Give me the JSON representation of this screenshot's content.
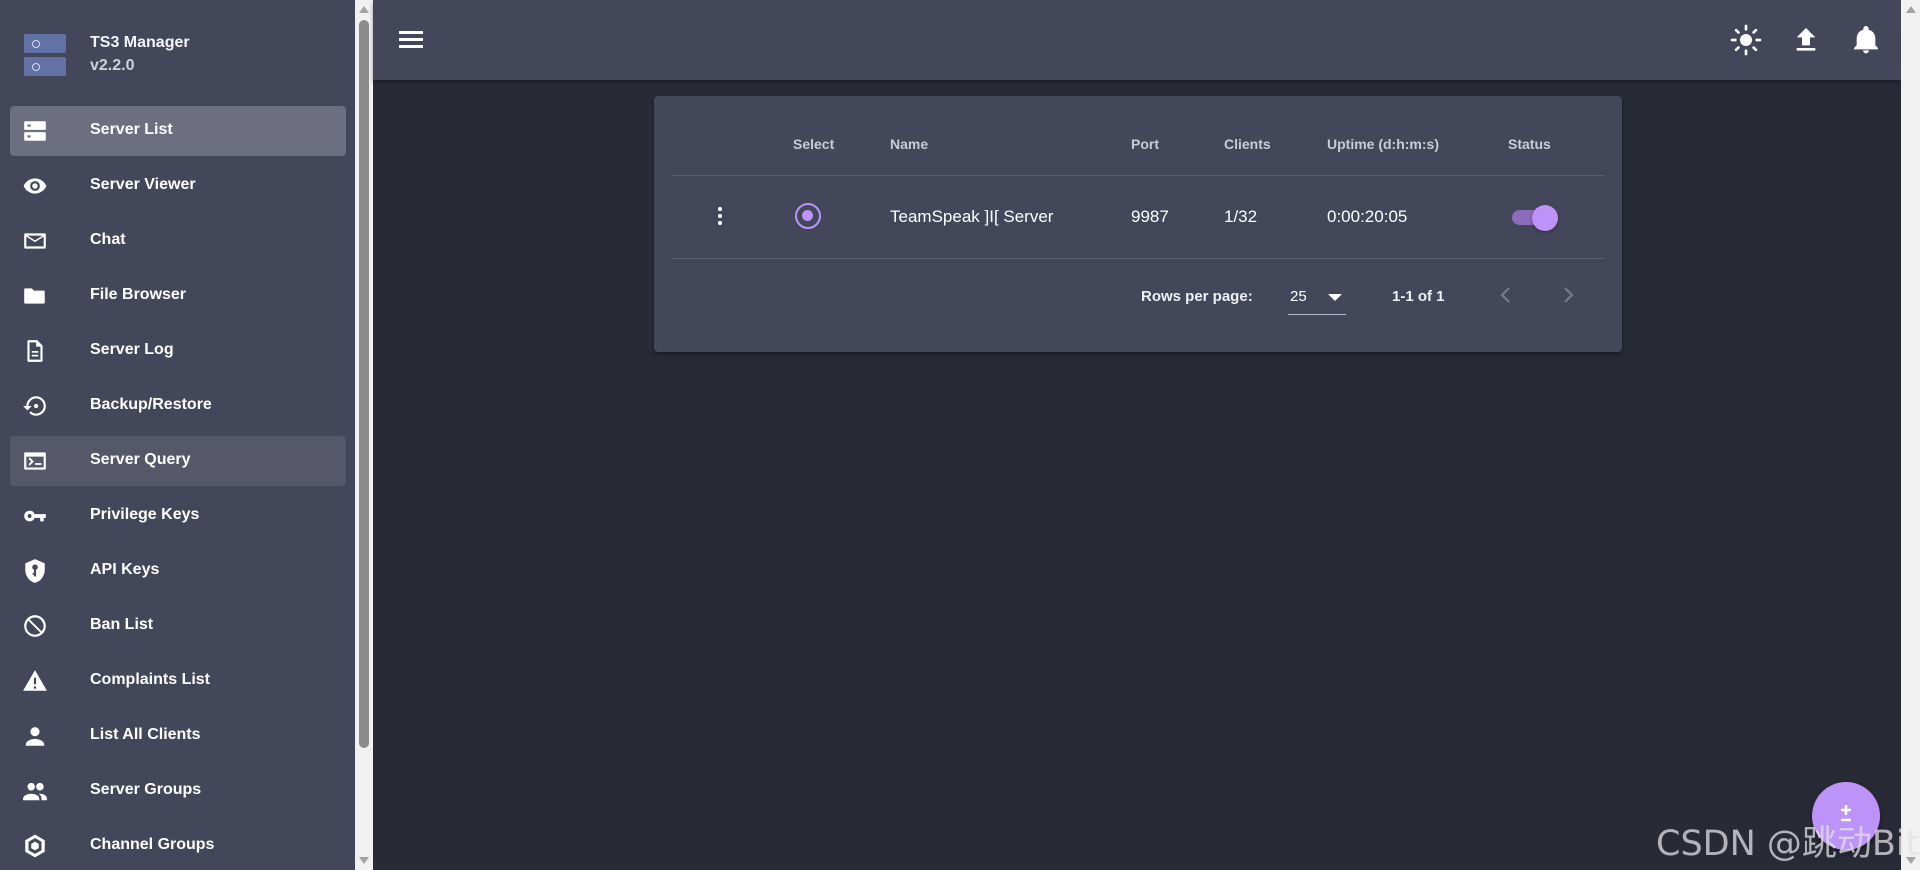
{
  "brand": {
    "title": "TS3 Manager",
    "version": "v2.2.0"
  },
  "sidebar": {
    "items": [
      {
        "label": "Server List",
        "icon": "server-list-icon"
      },
      {
        "label": "Server Viewer",
        "icon": "eye-icon"
      },
      {
        "label": "Chat",
        "icon": "envelope-icon"
      },
      {
        "label": "File Browser",
        "icon": "folder-icon"
      },
      {
        "label": "Server Log",
        "icon": "document-icon"
      },
      {
        "label": "Backup/Restore",
        "icon": "backup-restore-icon"
      },
      {
        "label": "Server Query",
        "icon": "console-icon"
      },
      {
        "label": "Privilege Keys",
        "icon": "key-icon"
      },
      {
        "label": "API Keys",
        "icon": "shield-key-icon"
      },
      {
        "label": "Ban List",
        "icon": "ban-icon"
      },
      {
        "label": "Complaints List",
        "icon": "warning-icon"
      },
      {
        "label": "List All Clients",
        "icon": "person-icon"
      },
      {
        "label": "Server Groups",
        "icon": "group-icon"
      },
      {
        "label": "Channel Groups",
        "icon": "channel-groups-icon"
      }
    ],
    "active": "Server List",
    "hovered": "Server Query"
  },
  "appbar": {
    "icons": [
      "menu-icon",
      "theme-sun-icon",
      "upload-icon",
      "bell-icon"
    ]
  },
  "table": {
    "headers": {
      "select": "Select",
      "name": "Name",
      "port": "Port",
      "clients": "Clients",
      "uptime": "Uptime (d:h:m:s)",
      "status": "Status"
    },
    "rows": [
      {
        "name": "TeamSpeak ]I[ Server",
        "port": "9987",
        "clients": "1/32",
        "uptime": "0:00:20:05",
        "selected": true,
        "status_on": true
      }
    ],
    "footer": {
      "rows_per_page_label": "Rows per page:",
      "rows_per_page_value": "25",
      "range": "1-1 of 1"
    }
  },
  "colors": {
    "accent": "#bd93f9",
    "panel": "#44475a",
    "background": "#282a36"
  },
  "fab": {
    "icon": "plus-minus-icon"
  },
  "watermark": "CSDN @跳动Bit"
}
